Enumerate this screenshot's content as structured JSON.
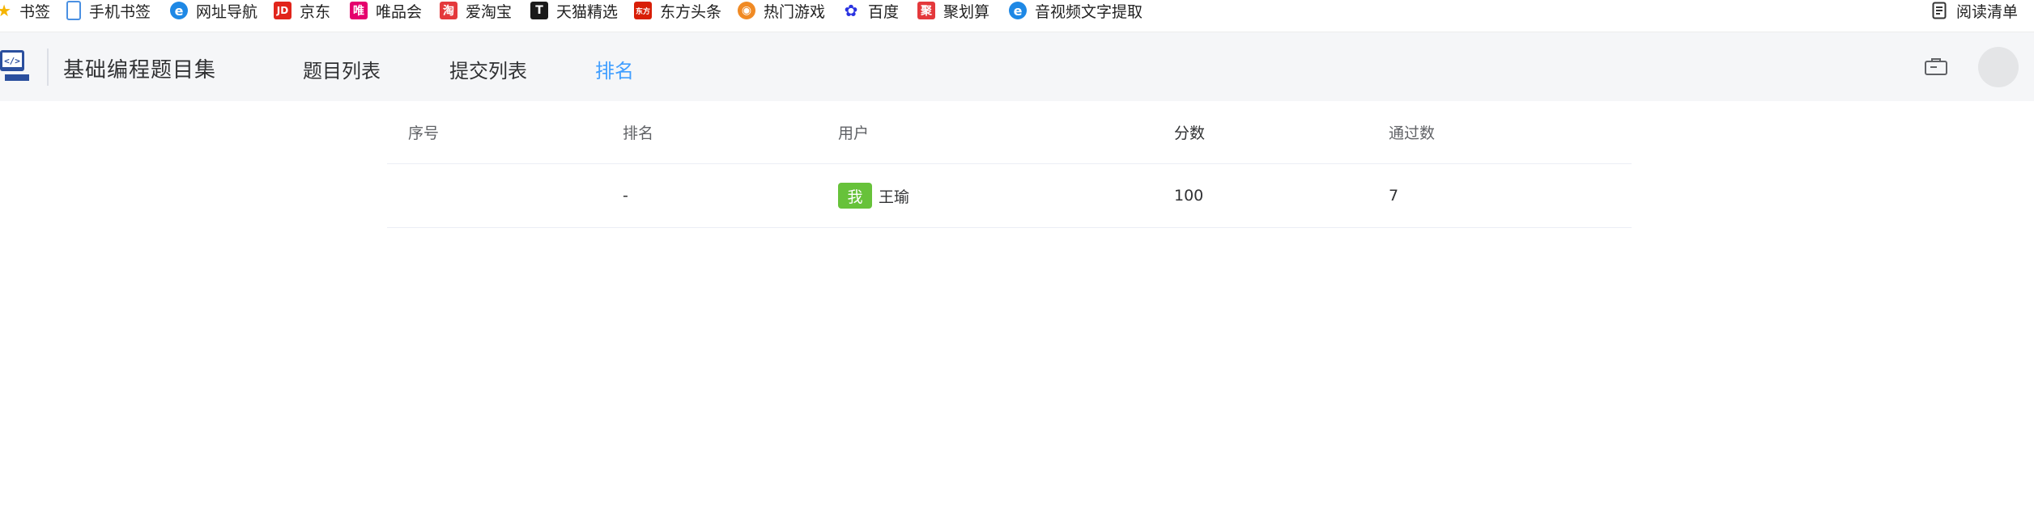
{
  "bookmarks": [
    {
      "label": "书签",
      "icon": "star-icon",
      "color": "#f5b400"
    },
    {
      "label": "手机书签",
      "icon": "phone-icon",
      "color": "#4a90e2"
    },
    {
      "label": "网址导航",
      "icon": "ie-icon",
      "color": "#1e88e5"
    },
    {
      "label": "京东",
      "icon": "jd-icon",
      "color": "#e1251b"
    },
    {
      "label": "唯品会",
      "icon": "vip-icon",
      "color": "#e5006d"
    },
    {
      "label": "爱淘宝",
      "icon": "taobao-icon",
      "color": "#e4393c"
    },
    {
      "label": "天猫精选",
      "icon": "tmall-icon",
      "color": "#1a1a1a"
    },
    {
      "label": "东方头条",
      "icon": "dongfang-icon",
      "color": "#d81e06"
    },
    {
      "label": "热门游戏",
      "icon": "game-icon",
      "color": "#f08a24"
    },
    {
      "label": "百度",
      "icon": "baidu-icon",
      "color": "#2932e1"
    },
    {
      "label": "聚划算",
      "icon": "juhuasuan-icon",
      "color": "#e4393c"
    },
    {
      "label": "音视频文字提取",
      "icon": "ie-icon",
      "color": "#1e88e5"
    }
  ],
  "bookmark_glyphs": {
    "jd": "JD",
    "vip": "唯",
    "taobao": "淘",
    "tmall": "T",
    "dongfang": "东方",
    "juhuasuan": "聚"
  },
  "reading_list": {
    "label": "阅读清单",
    "icon": "reading-list-icon"
  },
  "header": {
    "site_title": "基础编程题目集",
    "nav": [
      {
        "label": "题目列表",
        "active": false
      },
      {
        "label": "提交列表",
        "active": false
      },
      {
        "label": "排名",
        "active": true
      }
    ],
    "accent_color": "#409eff"
  },
  "table": {
    "columns": [
      "序号",
      "排名",
      "用户",
      "分数",
      "通过数"
    ],
    "rows": [
      {
        "index": "",
        "rank": "-",
        "me_tag": "我",
        "user": "王瑜",
        "score": "100",
        "passed": "7"
      }
    ],
    "tag_color": "#67c23a"
  }
}
